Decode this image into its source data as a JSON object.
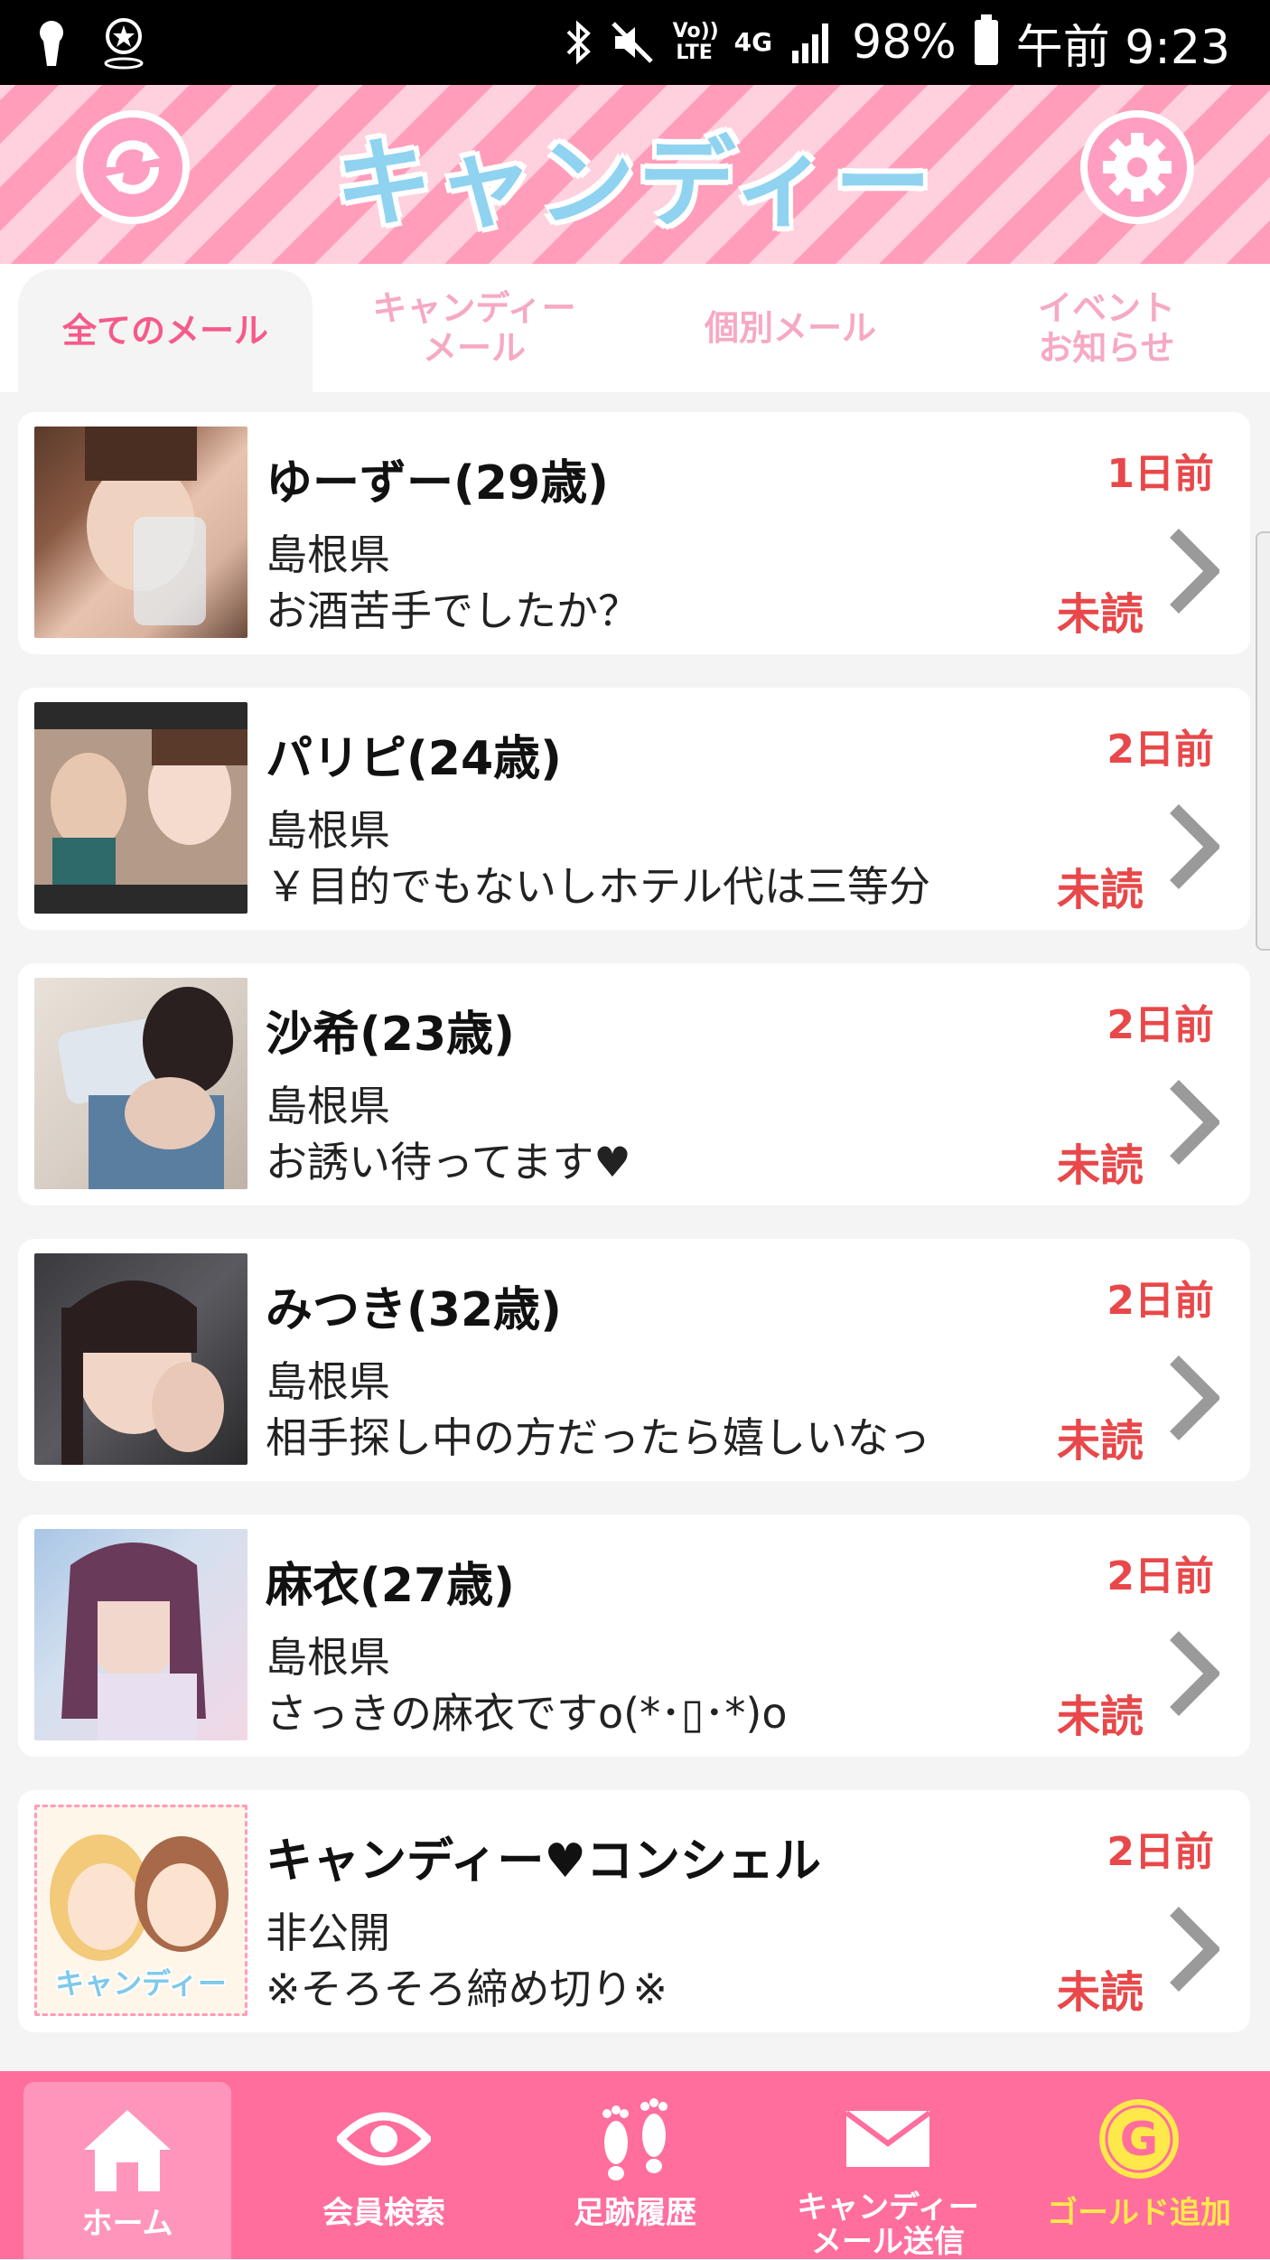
{
  "status_bar": {
    "battery": "98%",
    "time": "午前 9:23",
    "volte": "Vo)) LTE",
    "network": "4G"
  },
  "header": {
    "logo_text": "キャンディー"
  },
  "tabs": [
    {
      "label": "全てのメール",
      "active": true
    },
    {
      "label": "キャンディー\nメール",
      "active": false
    },
    {
      "label": "個別メール",
      "active": false
    },
    {
      "label": "イベント\nお知らせ",
      "active": false
    }
  ],
  "messages": [
    {
      "name": "ゆーずー(29歳)",
      "prefecture": "島根県",
      "preview": "お酒苦手でしたか？",
      "time": "1日前",
      "status": "未読"
    },
    {
      "name": "パリピ(24歳)",
      "prefecture": "島根県",
      "preview": "￥目的でもないしホテル代は三等分",
      "time": "2日前",
      "status": "未読"
    },
    {
      "name": "沙希(23歳)",
      "prefecture": "島根県",
      "preview": "お誘い待ってます♥",
      "time": "2日前",
      "status": "未読"
    },
    {
      "name": "みつき(32歳)",
      "prefecture": "島根県",
      "preview": "相手探し中の方だったら嬉しいなっ",
      "time": "2日前",
      "status": "未読"
    },
    {
      "name": "麻衣(27歳)",
      "prefecture": "島根県",
      "preview": "さっきの麻衣ですo(*･▯･*)o",
      "time": "2日前",
      "status": "未読"
    },
    {
      "name": "キャンディー♥コンシェル",
      "prefecture": "非公開",
      "preview": "※そろそろ締め切り※",
      "time": "2日前",
      "status": "未読",
      "thumb_text": "キャンディー"
    }
  ],
  "bottom_nav": [
    {
      "label": "ホーム",
      "icon": "home-icon",
      "active": true
    },
    {
      "label": "会員検索",
      "icon": "eye-icon",
      "active": false
    },
    {
      "label": "足跡履歴",
      "icon": "footprint-icon",
      "active": false
    },
    {
      "label": "キャンディー\nメール送信",
      "icon": "mail-icon",
      "active": false
    },
    {
      "label": "ゴールド追加",
      "icon": "gold-coin-icon",
      "active": false
    }
  ],
  "colors": {
    "accent_pink": "#ff6e9d",
    "unread_red": "#e8484a",
    "tab_active": "#f55a8a"
  }
}
